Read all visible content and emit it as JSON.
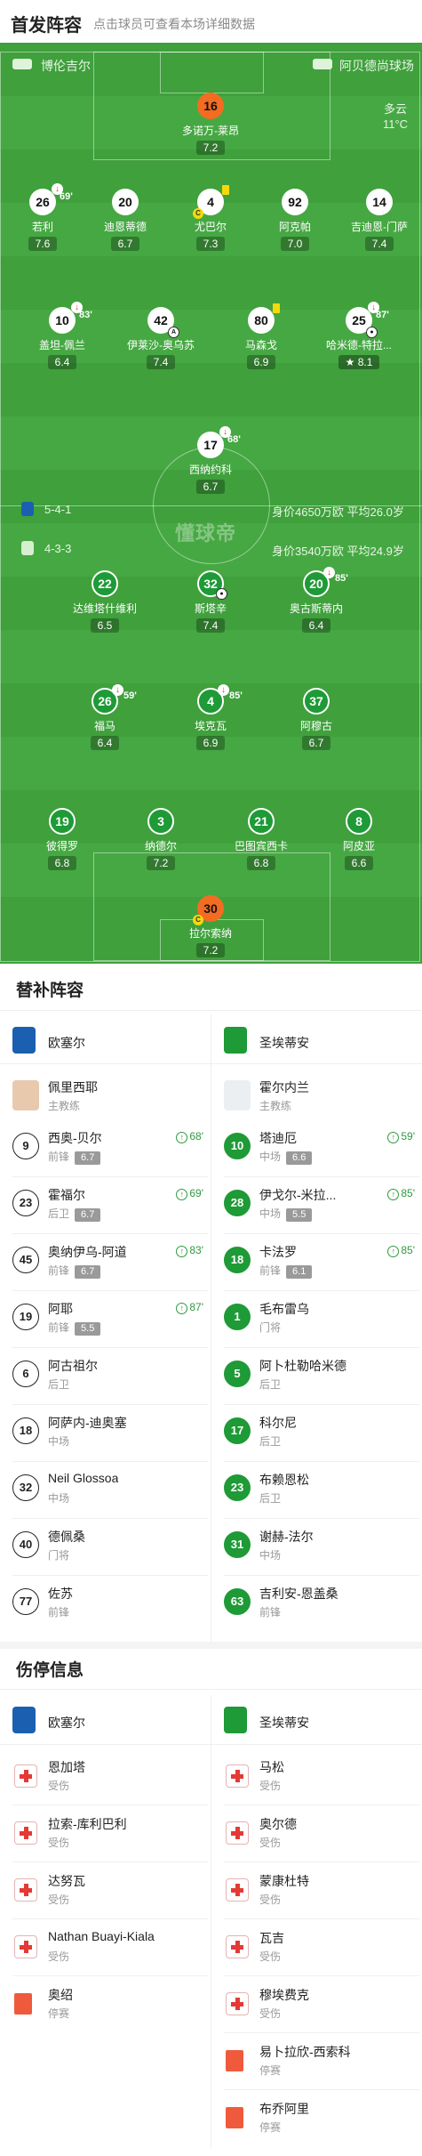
{
  "header": {
    "title": "首发阵容",
    "subtitle": "点击球员可查看本场详细数据"
  },
  "pitch": {
    "home_team": "博伦吉尔",
    "away_team": "阿贝德尚球场",
    "weather": {
      "condition": "多云",
      "temp": "11°C"
    },
    "watermark": "懂球帝",
    "home_formation": "5-4-1",
    "away_formation": "4-3-3",
    "home_value": "身价4650万欧 平均26.0岁",
    "away_value": "身价3540万欧 平均24.9岁",
    "home_players": [
      {
        "num": "16",
        "name": "多诺万-莱昂",
        "rating": "7.2"
      },
      {
        "num": "26",
        "name": "若利",
        "rating": "7.6",
        "sub_min": "69'"
      },
      {
        "num": "20",
        "name": "迪恩蒂德",
        "rating": "6.7"
      },
      {
        "num": "4",
        "name": "尤巴尔",
        "rating": "7.3"
      },
      {
        "num": "92",
        "name": "阿克帕",
        "rating": "7.0"
      },
      {
        "num": "14",
        "name": "吉迪恩-门萨",
        "rating": "7.4"
      },
      {
        "num": "10",
        "name": "盖坦-佩兰",
        "rating": "6.4",
        "sub_min": "83'"
      },
      {
        "num": "42",
        "name": "伊莱沙-奥乌苏",
        "rating": "7.4"
      },
      {
        "num": "80",
        "name": "马森戈",
        "rating": "6.9"
      },
      {
        "num": "25",
        "name": "哈米德-特拉...",
        "rating": "8.1",
        "sub_min": "87'"
      },
      {
        "num": "17",
        "name": "西纳约科",
        "rating": "6.7",
        "sub_min": "68'"
      }
    ],
    "away_players": [
      {
        "num": "22",
        "name": "达维塔什维利",
        "rating": "6.5"
      },
      {
        "num": "32",
        "name": "斯塔辛",
        "rating": "7.4"
      },
      {
        "num": "20",
        "name": "奥古斯蒂内",
        "rating": "6.4",
        "sub_min": "85'"
      },
      {
        "num": "26",
        "name": "福马",
        "rating": "6.4",
        "sub_min": "59'"
      },
      {
        "num": "4",
        "name": "埃克瓦",
        "rating": "6.9",
        "sub_min": "85'"
      },
      {
        "num": "37",
        "name": "阿穆古",
        "rating": "6.7"
      },
      {
        "num": "19",
        "name": "彼得罗",
        "rating": "6.8"
      },
      {
        "num": "3",
        "name": "纳德尔",
        "rating": "7.2"
      },
      {
        "num": "21",
        "name": "巴图宾西卡",
        "rating": "6.8"
      },
      {
        "num": "8",
        "name": "阿皮亚",
        "rating": "6.6"
      },
      {
        "num": "30",
        "name": "拉尔索纳",
        "rating": "7.2"
      }
    ]
  },
  "subs": {
    "title": "替补阵容",
    "home_team": "欧塞尔",
    "away_team": "圣埃蒂安",
    "home_coach": {
      "name": "佩里西耶",
      "role": "主教练"
    },
    "away_coach": {
      "name": "霍尔内兰",
      "role": "主教练"
    },
    "home": [
      {
        "num": "9",
        "name": "西奥-贝尔",
        "pos": "前锋",
        "rating": "6.7",
        "in": "68'"
      },
      {
        "num": "23",
        "name": "霍福尔",
        "pos": "后卫",
        "rating": "6.7",
        "in": "69'"
      },
      {
        "num": "45",
        "name": "奥纳伊乌-阿道",
        "pos": "前锋",
        "rating": "6.7",
        "in": "83'"
      },
      {
        "num": "19",
        "name": "阿耶",
        "pos": "前锋",
        "rating": "5.5",
        "in": "87'"
      },
      {
        "num": "6",
        "name": "阿古祖尔",
        "pos": "后卫"
      },
      {
        "num": "18",
        "name": "阿萨内-迪奥塞",
        "pos": "中场"
      },
      {
        "num": "32",
        "name": "Neil Glossoa",
        "pos": "中场"
      },
      {
        "num": "40",
        "name": "德佩桑",
        "pos": "门将"
      },
      {
        "num": "77",
        "name": "佐苏",
        "pos": "前锋"
      }
    ],
    "away": [
      {
        "num": "10",
        "name": "塔迪厄",
        "pos": "中场",
        "rating": "6.6",
        "in": "59'"
      },
      {
        "num": "28",
        "name": "伊戈尔-米拉...",
        "pos": "中场",
        "rating": "5.5",
        "in": "85'"
      },
      {
        "num": "18",
        "name": "卡法罗",
        "pos": "前锋",
        "rating": "6.1",
        "in": "85'"
      },
      {
        "num": "1",
        "name": "毛布雷乌",
        "pos": "门将"
      },
      {
        "num": "5",
        "name": "阿卜杜勒哈米德",
        "pos": "后卫"
      },
      {
        "num": "17",
        "name": "科尔尼",
        "pos": "后卫"
      },
      {
        "num": "23",
        "name": "布赖恩松",
        "pos": "后卫"
      },
      {
        "num": "31",
        "name": "谢赫-法尔",
        "pos": "中场"
      },
      {
        "num": "63",
        "name": "吉利安-恩盖桑",
        "pos": "前锋"
      }
    ]
  },
  "injuries": {
    "title": "伤停信息",
    "home_team": "欧塞尔",
    "away_team": "圣埃蒂安",
    "home": [
      {
        "name": "恩加塔",
        "status": "受伤",
        "type": "injury"
      },
      {
        "name": "拉索-库利巴利",
        "status": "受伤",
        "type": "injury"
      },
      {
        "name": "达努瓦",
        "status": "受伤",
        "type": "injury"
      },
      {
        "name": "Nathan Buayi-Kiala",
        "status": "受伤",
        "type": "injury"
      },
      {
        "name": "奥绍",
        "status": "停赛",
        "type": "suspension"
      }
    ],
    "away": [
      {
        "name": "马松",
        "status": "受伤",
        "type": "injury"
      },
      {
        "name": "奥尔德",
        "status": "受伤",
        "type": "injury"
      },
      {
        "name": "蒙康杜特",
        "status": "受伤",
        "type": "injury"
      },
      {
        "name": "瓦吉",
        "status": "受伤",
        "type": "injury"
      },
      {
        "name": "穆埃费克",
        "status": "受伤",
        "type": "injury"
      },
      {
        "name": "易卜拉欣-西索科",
        "status": "停赛",
        "type": "suspension"
      },
      {
        "name": "布乔阿里",
        "status": "停赛",
        "type": "suspension"
      }
    ]
  },
  "colors": {
    "pitch": "#3fa03c",
    "home_badge": "#1b5fb0",
    "away_badge": "#1e9a36",
    "goalkeeper": "#f36c21"
  }
}
